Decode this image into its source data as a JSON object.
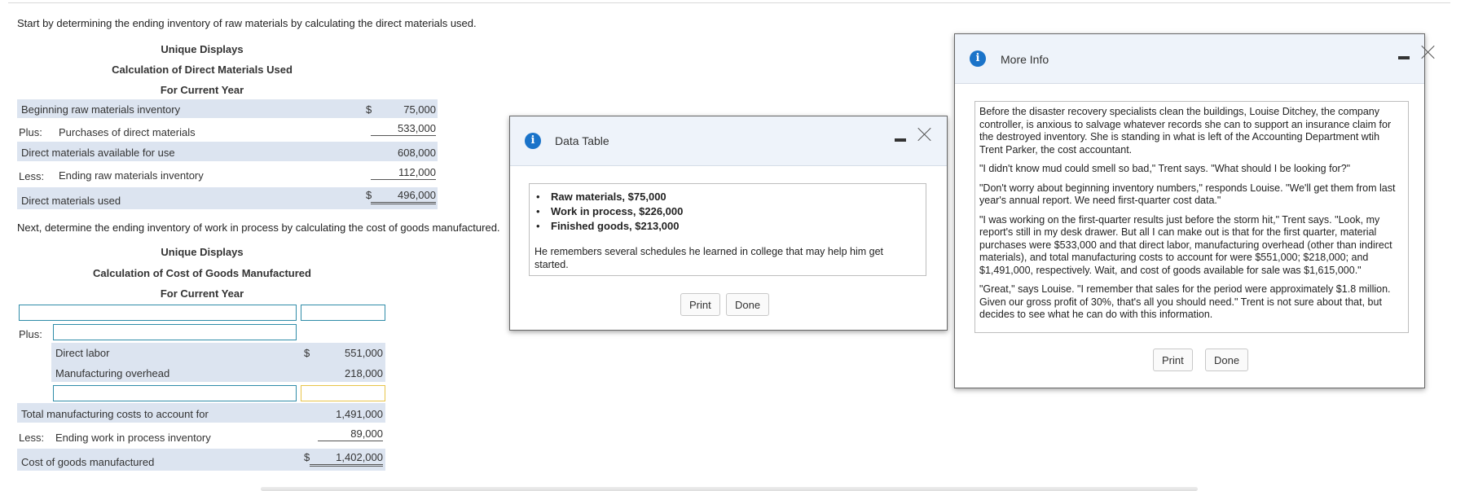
{
  "instructions": {
    "step1": "Start by determining the ending inventory of raw materials by calculating the direct materials used.",
    "step2": "Next, determine the ending inventory of work in process by calculating the cost of goods manufactured."
  },
  "dm_schedule": {
    "company": "Unique Displays",
    "title": "Calculation of Direct Materials Used",
    "period": "For Current Year",
    "rows": [
      {
        "prefix": "",
        "label": "Beginning raw materials inventory",
        "dollar": "$",
        "value": "75,000"
      },
      {
        "prefix": "Plus:",
        "label": "Purchases of direct materials",
        "dollar": "",
        "value": "533,000"
      },
      {
        "prefix": "",
        "label": "Direct materials available for use",
        "dollar": "",
        "value": "608,000"
      },
      {
        "prefix": "Less:",
        "label": "Ending raw materials inventory",
        "dollar": "",
        "value": "112,000"
      },
      {
        "prefix": "",
        "label": "Direct materials used",
        "dollar": "$",
        "value": "496,000"
      }
    ]
  },
  "cogm_schedule": {
    "company": "Unique Displays",
    "title": "Calculation of Cost of Goods Manufactured",
    "period": "For Current Year",
    "plus_label": "Plus:",
    "less_label": "Less:",
    "rows": [
      {
        "label": "Direct labor",
        "dollar": "$",
        "value": "551,000"
      },
      {
        "label": "Manufacturing overhead",
        "dollar": "",
        "value": "218,000"
      },
      {
        "label": "Total manufacturing costs to account for",
        "dollar": "",
        "value": "1,491,000"
      },
      {
        "label": "Ending work in process inventory",
        "dollar": "",
        "value": "89,000"
      },
      {
        "label": "Cost of goods manufactured",
        "dollar": "$",
        "value": "1,402,000"
      }
    ]
  },
  "data_table_modal": {
    "title": "Data Table",
    "items": [
      "Raw materials, $75,000",
      "Work in process, $226,000",
      "Finished goods, $213,000"
    ],
    "note": "He remembers several schedules he learned in college that may help him get started.",
    "print_label": "Print",
    "done_label": "Done"
  },
  "more_info_modal": {
    "title": "More Info",
    "paragraphs": [
      "Before the disaster recovery specialists clean the buildings, Louise Ditchey, the company controller, is anxious to salvage whatever records she can to support an insurance claim for the destroyed inventory. She is standing in what is left of the Accounting Department wtih Trent Parker, the cost accountant.",
      "\"I didn't know mud could smell so bad,\" Trent says. \"What should I be looking for?\"",
      "\"Don't worry about beginning inventory numbers,\" responds Louise. \"We'll get them from last year's annual report. We need first-quarter cost data.\"",
      "\"I was working on the first-quarter results just before the storm hit,\" Trent says. \"Look, my report's still in my desk drawer. But all I can make out is that for the first quarter, material purchases were $533,000 and that direct labor, manufacturing overhead (other than indirect materials), and total manufacturing costs to account for were $551,000; $218,000; and $1,491,000, respectively. Wait, and cost of goods available for sale was $1,615,000.\"",
      "\"Great,\" says Louise. \"I remember that sales for the period were approximately $1.8 million. Given our gross profit of 30%, that's all you should need.\" Trent is not sure about that, but decides to see what he can do with this information."
    ],
    "print_label": "Print",
    "done_label": "Done"
  },
  "icons": {
    "info": "info-icon",
    "minimize": "minimize-icon",
    "close": "close-icon"
  },
  "colors": {
    "band": "#dce4f0",
    "input_border": "#2f8ca8",
    "input_highlight": "#e8c44a",
    "info_icon": "#1a73c9"
  }
}
